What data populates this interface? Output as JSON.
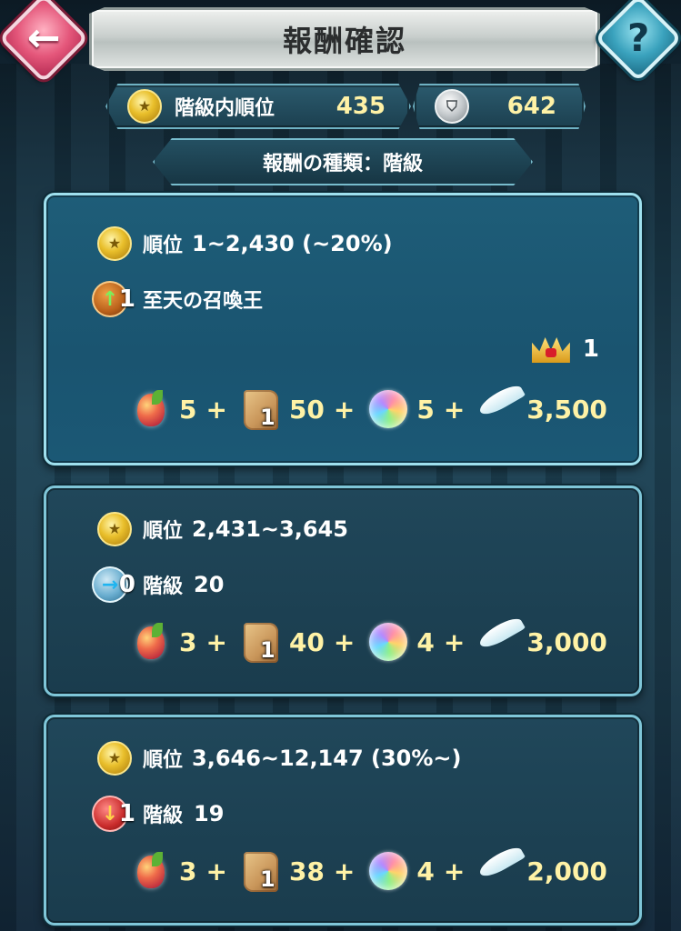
{
  "header": {
    "title": "報酬確認",
    "back_icon": "←",
    "help_icon": "?"
  },
  "stats": {
    "rank_label": "階級内順位",
    "rank_value": "435",
    "score_value": "642"
  },
  "reward_type": "報酬の種類：階級",
  "cards": [
    {
      "rank_label": "順位",
      "rank_range": "1~2,430 (~20%)",
      "tier_badge": "1",
      "tier_text": "至天の召喚王",
      "tier_value": "",
      "crown_value": "1",
      "items": [
        "5",
        "50",
        "5",
        "3,500"
      ],
      "scroll_badge": "1"
    },
    {
      "rank_label": "順位",
      "rank_range": "2,431~3,645",
      "tier_badge": "0",
      "tier_text": "階級",
      "tier_value": "20",
      "items": [
        "3",
        "40",
        "4",
        "3,000"
      ],
      "scroll_badge": "1"
    },
    {
      "rank_label": "順位",
      "rank_range": "3,646~12,147 (30%~)",
      "tier_badge": "1",
      "tier_text": "階級",
      "tier_value": "19",
      "items": [
        "3",
        "38",
        "4",
        "2,000"
      ],
      "scroll_badge": "1"
    }
  ],
  "plus_sign": "+",
  "colors": {
    "accent_value": "#fff2a6",
    "frame": "#7fc6d8",
    "tier_up": "#7bf05b",
    "tier_down": "#ffd24a"
  }
}
